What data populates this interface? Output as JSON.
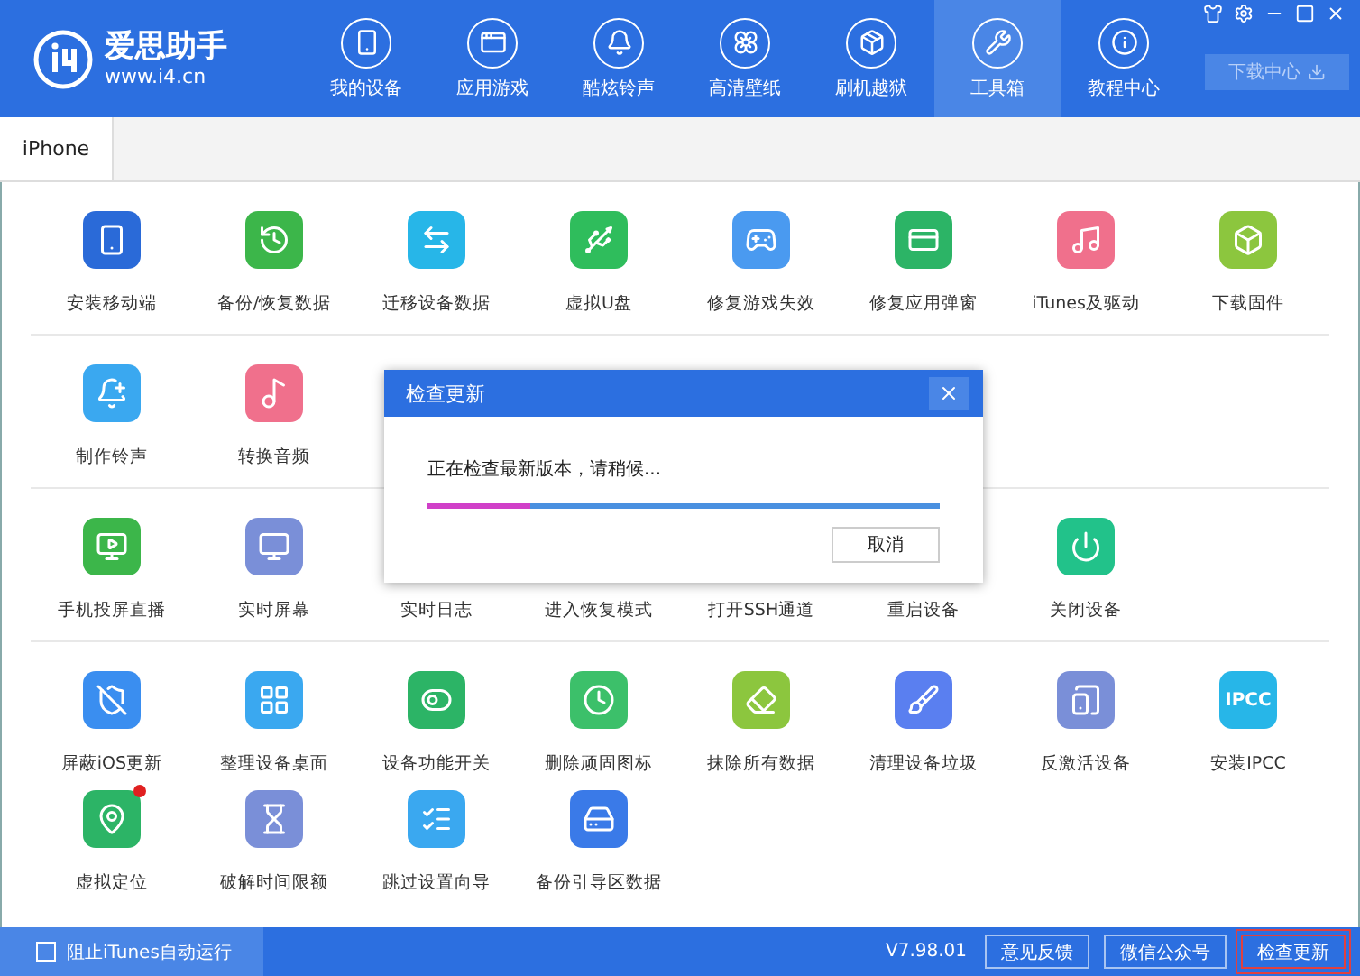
{
  "app": {
    "name": "爱思助手",
    "url": "www.i4.cn"
  },
  "nav": [
    {
      "label": "我的设备",
      "selected": false
    },
    {
      "label": "应用游戏",
      "selected": false
    },
    {
      "label": "酷炫铃声",
      "selected": false
    },
    {
      "label": "高清壁纸",
      "selected": false
    },
    {
      "label": "刷机越狱",
      "selected": false
    },
    {
      "label": "工具箱",
      "selected": true
    },
    {
      "label": "教程中心",
      "selected": false
    }
  ],
  "download_center": "下载中心",
  "tabs": [
    {
      "label": "iPhone",
      "selected": true
    }
  ],
  "sections": [
    {
      "items": [
        {
          "kind": "tool",
          "label": "安装移动端",
          "color": "#2a6ad8",
          "dot": false
        },
        {
          "kind": "tool",
          "label": "备份/恢复数据",
          "color": "#3cb64a",
          "dot": false
        },
        {
          "kind": "tool",
          "label": "迁移设备数据",
          "color": "#27b6e8",
          "dot": false
        },
        {
          "kind": "tool",
          "label": "虚拟U盘",
          "color": "#2fbd5c",
          "dot": false
        },
        {
          "kind": "tool",
          "label": "修复游戏失效",
          "color": "#4a9af0",
          "dot": false
        },
        {
          "kind": "tool",
          "label": "修复应用弹窗",
          "color": "#2cb466",
          "dot": false
        },
        {
          "kind": "tool",
          "label": "iTunes及驱动",
          "color": "#f0708c",
          "dot": false
        },
        {
          "kind": "tool",
          "label": "下载固件",
          "color": "#8cc63e",
          "dot": false
        }
      ]
    },
    {
      "items": [
        {
          "kind": "tool",
          "label": "制作铃声",
          "color": "#3aa8f0",
          "dot": false
        },
        {
          "kind": "tool",
          "label": "转换音频",
          "color": "#f0708c",
          "dot": false
        }
      ]
    },
    {
      "items": [
        {
          "kind": "tool",
          "label": "手机投屏直播",
          "color": "#3cb64a",
          "dot": false
        },
        {
          "kind": "tool",
          "label": "实时屏幕",
          "color": "#7a8fd8",
          "dot": false
        },
        {
          "kind": "label",
          "label": "实时日志"
        },
        {
          "kind": "label",
          "label": "进入恢复模式"
        },
        {
          "kind": "label",
          "label": "打开SSH通道"
        },
        {
          "kind": "label",
          "label": "重启设备"
        },
        {
          "kind": "tool",
          "label": "关闭设备",
          "color": "#22c28a",
          "dot": false
        }
      ]
    },
    {
      "items": [
        {
          "kind": "tool",
          "label": "屏蔽iOS更新",
          "color": "#3a8ef0",
          "dot": false
        },
        {
          "kind": "tool",
          "label": "整理设备桌面",
          "color": "#3aa8f0",
          "dot": false
        },
        {
          "kind": "tool",
          "label": "设备功能开关",
          "color": "#2cb466",
          "dot": false
        },
        {
          "kind": "tool",
          "label": "删除顽固图标",
          "color": "#3cc06a",
          "dot": false
        },
        {
          "kind": "tool",
          "label": "抹除所有数据",
          "color": "#8cc63e",
          "dot": false
        },
        {
          "kind": "tool",
          "label": "清理设备垃圾",
          "color": "#5a7ff0",
          "dot": false
        },
        {
          "kind": "tool",
          "label": "反激活设备",
          "color": "#7a8fd8",
          "dot": false
        },
        {
          "kind": "tool",
          "label": "安装IPCC",
          "color": "#27b6e8",
          "dot": false,
          "icon_text": "IPCC"
        },
        {
          "kind": "tool",
          "label": "虚拟定位",
          "color": "#2cb466",
          "dot": true
        },
        {
          "kind": "tool",
          "label": "破解时间限额",
          "color": "#7a8fd8",
          "dot": false
        },
        {
          "kind": "tool",
          "label": "跳过设置向导",
          "color": "#3aa8f0",
          "dot": false
        },
        {
          "kind": "tool",
          "label": "备份引导区数据",
          "color": "#3a7ae8",
          "dot": false
        }
      ]
    }
  ],
  "dialog": {
    "title": "检查更新",
    "message": "正在检查最新版本，请稍候...",
    "level": 0.2,
    "cancel": "取消"
  },
  "footer": {
    "itunes_block": {
      "label": "阻止iTunes自动运行",
      "checked": false
    },
    "version": "V7.98.01",
    "buttons": [
      {
        "label": "意见反馈",
        "highlighted": false
      },
      {
        "label": "微信公众号",
        "highlighted": false
      },
      {
        "label": "检查更新",
        "highlighted": true
      }
    ]
  }
}
